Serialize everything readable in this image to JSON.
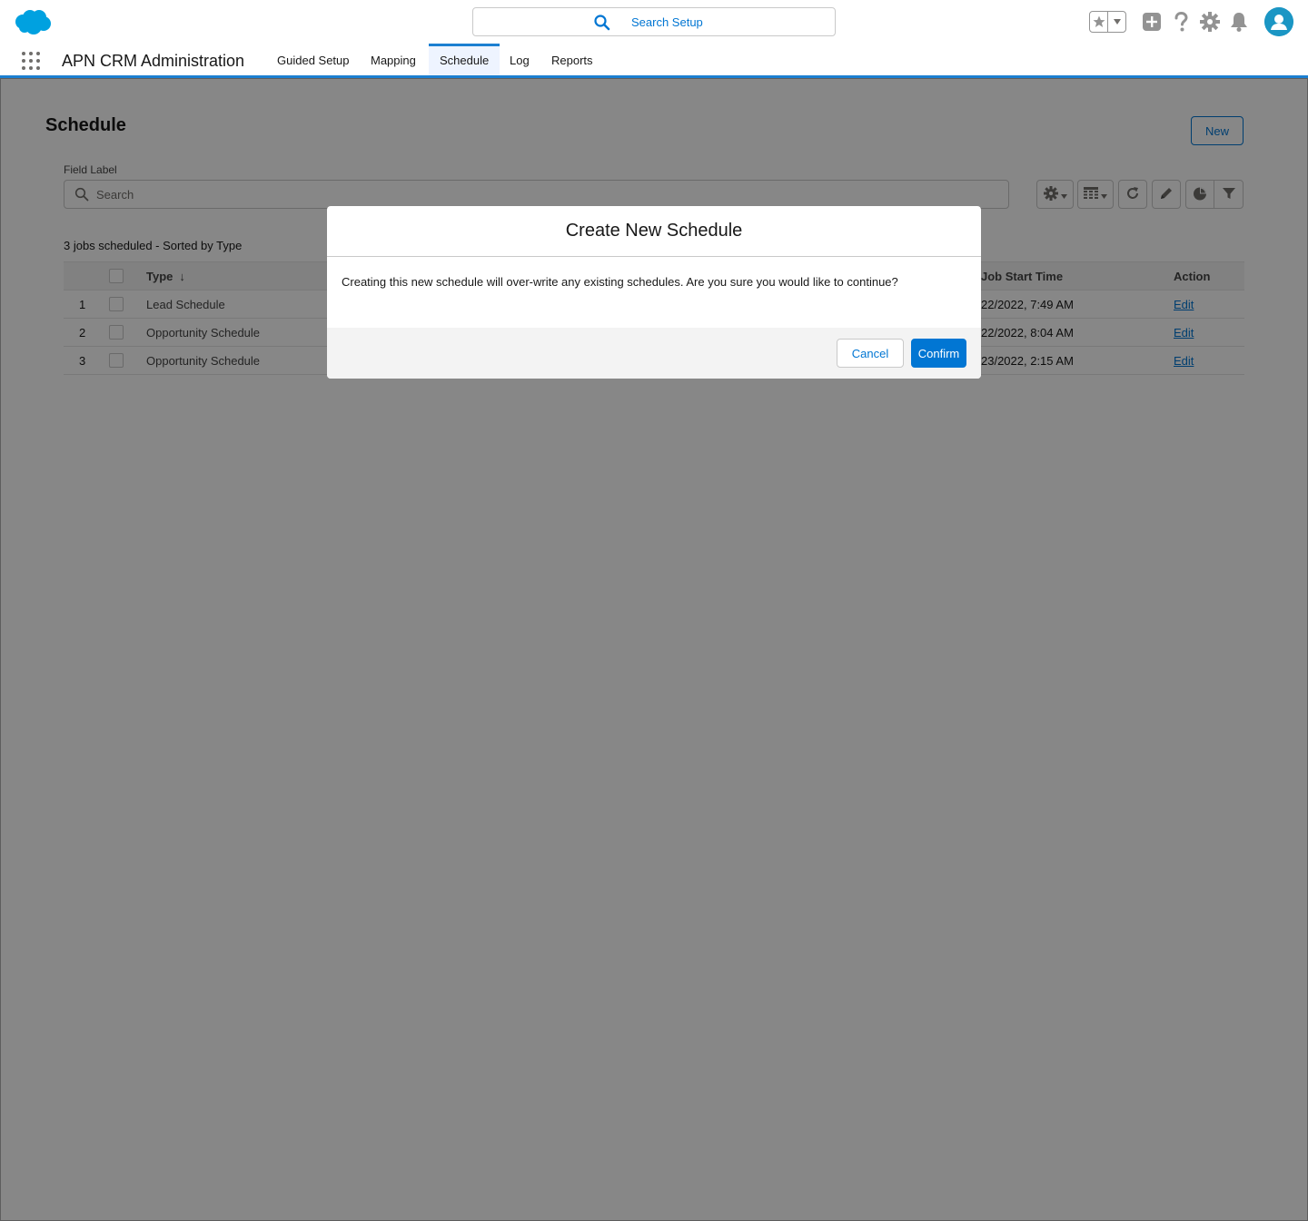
{
  "header": {
    "search_placeholder": "Search Setup"
  },
  "nav": {
    "app_name": "APN CRM Administration",
    "tabs": [
      {
        "label": "Guided Setup"
      },
      {
        "label": "Mapping"
      },
      {
        "label": "Schedule",
        "active": true
      },
      {
        "label": "Log"
      },
      {
        "label": "Reports"
      }
    ]
  },
  "page": {
    "title": "Schedule",
    "new_label": "New",
    "field_label": "Field Label",
    "search_placeholder": "Search",
    "count_text": "3 jobs scheduled - Sorted by Type"
  },
  "table": {
    "columns": {
      "type": "Type",
      "sort_arrow": "↓",
      "start_time": "Job Start Time",
      "action": "Action"
    },
    "rows": [
      {
        "num": "1",
        "type": "Lead Schedule",
        "start_time": "22/2022, 7:49 AM",
        "action": "Edit"
      },
      {
        "num": "2",
        "type": "Opportunity Schedule",
        "start_time": "22/2022, 8:04 AM",
        "action": "Edit"
      },
      {
        "num": "3",
        "type": "Opportunity Schedule",
        "start_time": "23/2022, 2:15 AM",
        "action": "Edit"
      }
    ]
  },
  "modal": {
    "title": "Create New Schedule",
    "body": "Creating this new schedule will over-write any existing schedules. Are you sure you would like to continue?",
    "cancel_label": "Cancel",
    "confirm_label": "Confirm"
  },
  "colors": {
    "brand": "#0176d3",
    "cloud": "#00a1e0",
    "backdrop": "rgba(0,0,0,0.47)"
  },
  "icons": [
    "salesforce-cloud-logo",
    "search-icon",
    "favorites-star-icon",
    "add-icon",
    "help-icon",
    "setup-gear-icon",
    "notifications-bell-icon",
    "avatar-icon",
    "app-launcher-icon",
    "list-settings-icon",
    "display-as-table-icon",
    "refresh-icon",
    "edit-icon",
    "chart-icon",
    "filter-icon"
  ]
}
